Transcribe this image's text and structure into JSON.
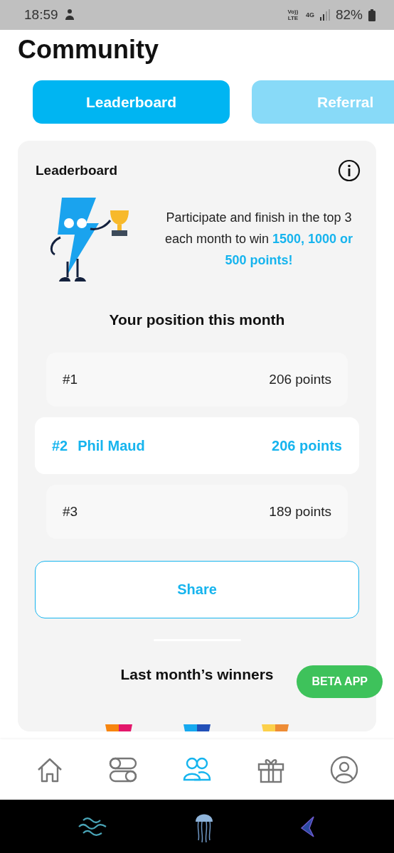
{
  "status_bar": {
    "time": "18:59",
    "volte": "Vo)) LTE",
    "network": "4G",
    "battery": "82%"
  },
  "title": "Community",
  "tabs": [
    {
      "label": "Leaderboard",
      "selected": true
    },
    {
      "label": "Referral",
      "selected": false
    }
  ],
  "card": {
    "title": "Leaderboard",
    "description": "Participate and finish in the top 3 each month to win **1500, 1000 or 500 points!**",
    "position_heading": "Your position this month",
    "rows": [
      {
        "rank": "#1",
        "points": "206 points",
        "selected": false
      },
      {
        "rank": "#2",
        "name": "Phil Maud",
        "points": "206 points",
        "selected": true
      },
      {
        "rank": "#3",
        "points": "189 points",
        "selected": false
      }
    ],
    "share_button": "Share",
    "winners_heading": "Last month’s winners"
  },
  "beta_badge": "BETA APP",
  "nav": [
    {
      "kind": "home",
      "selected": false
    },
    {
      "kind": "toggles",
      "selected": false
    },
    {
      "kind": "community",
      "selected": true
    },
    {
      "kind": "gift",
      "selected": false
    },
    {
      "kind": "profile",
      "selected": false
    }
  ]
}
